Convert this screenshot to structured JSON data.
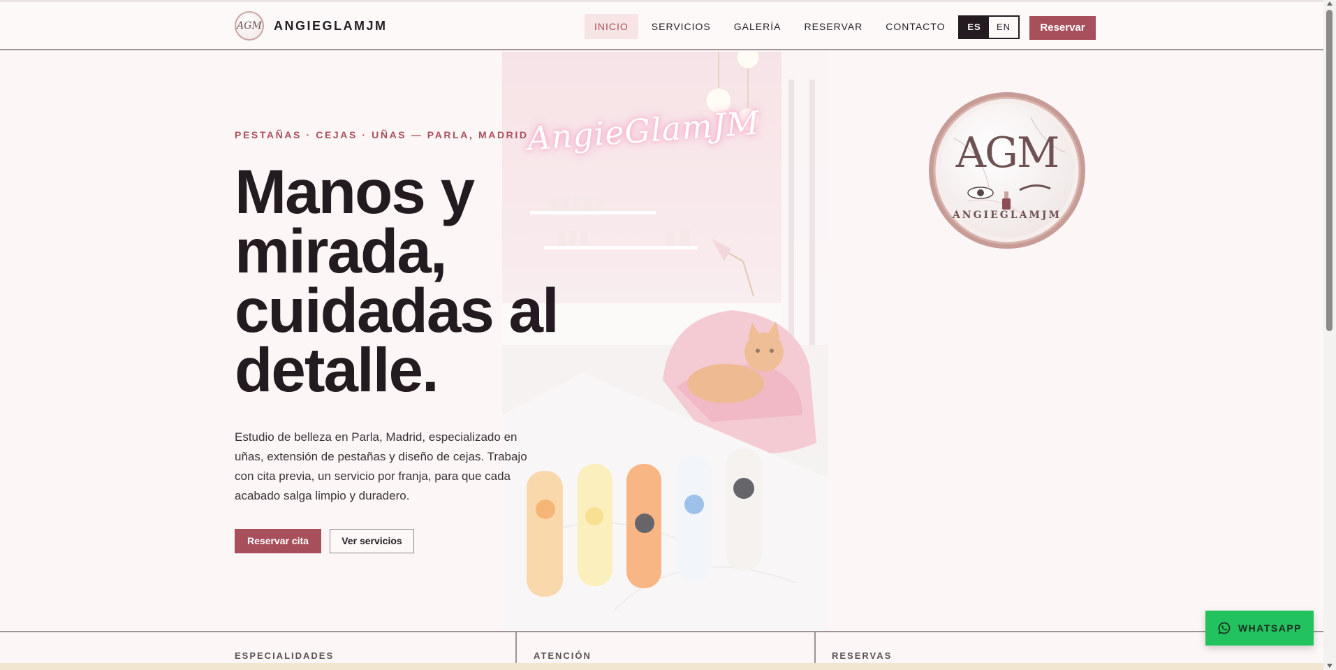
{
  "header": {
    "brand_name": "ANGIEGLAMJM",
    "logo_mark": "AGM",
    "nav": [
      {
        "label": "INICIO",
        "active": true
      },
      {
        "label": "SERVICIOS",
        "active": false
      },
      {
        "label": "GALERÍA",
        "active": false
      },
      {
        "label": "RESERVAR",
        "active": false
      },
      {
        "label": "CONTACTO",
        "active": false
      }
    ],
    "lang_es": "ES",
    "lang_en": "EN",
    "cta_label": "Reservar"
  },
  "hero": {
    "eyebrow": "PESTAÑAS · CEJAS · UÑAS — PARLA, MADRID",
    "headline": "Manos y mirada, cuidadas al detalle.",
    "lead": "Estudio de belleza en Parla, Madrid, especializado en uñas, extensión de pestañas y diseño de cejas. Trabajo con cita previa, un servicio por franja, para que cada acabado salga limpio y duradero.",
    "primary_button": "Reservar cita",
    "secondary_button": "Ver servicios",
    "neon_sign": "AngieGlamJM"
  },
  "seal": {
    "monogram": "AGM",
    "ring_text": "ANGIEGLAMJM"
  },
  "strip": {
    "col1": "ESPECIALIDADES",
    "col2": "ATENCIÓN",
    "col3": "RESERVAS"
  },
  "whatsapp_label": "WHATSAPP",
  "colors": {
    "accent": "#a84f5c",
    "dark": "#241b21",
    "whatsapp": "#22c35e",
    "background": "#fcf7f6"
  }
}
